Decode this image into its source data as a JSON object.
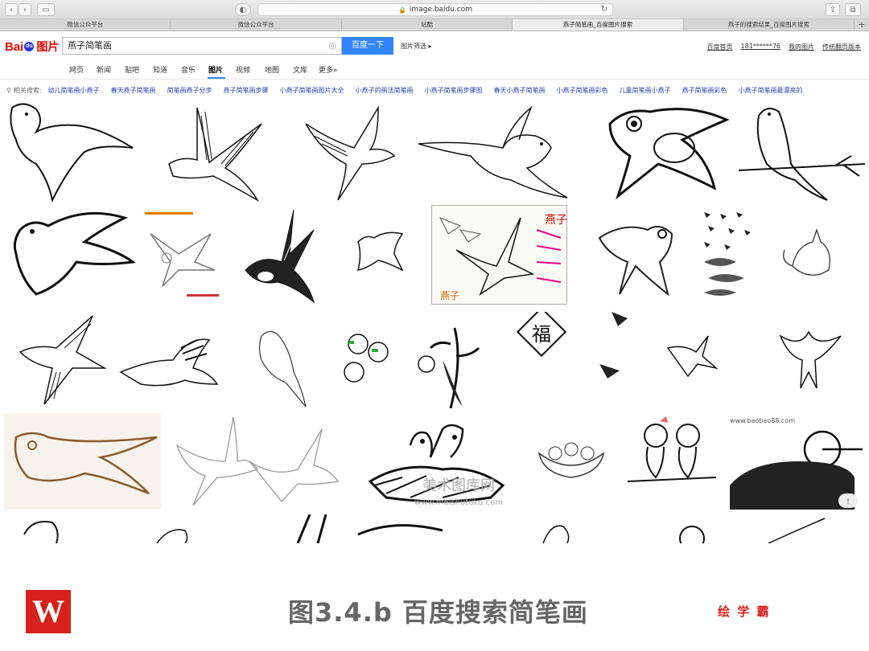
{
  "browser": {
    "url": "image.baidu.com",
    "tabs": [
      {
        "label": "微信公众平台",
        "active": false
      },
      {
        "label": "微信公众平台",
        "active": false
      },
      {
        "label": "站酷",
        "active": false
      },
      {
        "label": "燕子简笔画_百度图片搜索",
        "active": true
      },
      {
        "label": "燕子的搜索结果_百度图片搜索",
        "active": false
      }
    ],
    "new_tab": "+"
  },
  "header": {
    "logo_text": "Bai",
    "logo_paw": "du",
    "logo_pic": "图片",
    "search_value": "燕子简笔画",
    "search_button": "百度一下",
    "filter_label": "图片筛选",
    "user_links": [
      "百度首页",
      "181******76",
      "我的图片",
      "传统翻页版本"
    ]
  },
  "nav": {
    "items": [
      "网页",
      "新闻",
      "贴吧",
      "知道",
      "音乐",
      "图片",
      "视频",
      "地图",
      "文库",
      "更多»"
    ],
    "active": "图片"
  },
  "related": {
    "label": "相关搜索:",
    "terms": [
      "幼儿简笔画小燕子",
      "春天燕子简笔画",
      "简笔画燕子分步",
      "燕子简笔画步骤",
      "小燕子简笔画图片大全",
      "小燕子的画法简笔画",
      "小燕子简笔画步骤图",
      "春天小燕子简笔画",
      "小燕子简笔画彩色",
      "儿童简笔画小燕子",
      "燕子简笔画彩色",
      "小燕子简笔画最漂亮的"
    ]
  },
  "grid_texts": {
    "fu": "福",
    "yanzi": "燕子",
    "watermark": "美术图库网",
    "watermark_url": "www.meishutuku.com",
    "baobao": "www.baobao88.com",
    "badge": "!"
  },
  "footer": {
    "logo_letter": "W",
    "caption": "图3.4.b  百度搜索简笔画",
    "brand": "绘 学 霸"
  },
  "colors": {
    "baidu_red": "#e10601",
    "baidu_blue": "#2932e1",
    "search_button": "#3385ff",
    "link": "#2440b3",
    "brand_red": "#d8211a"
  }
}
